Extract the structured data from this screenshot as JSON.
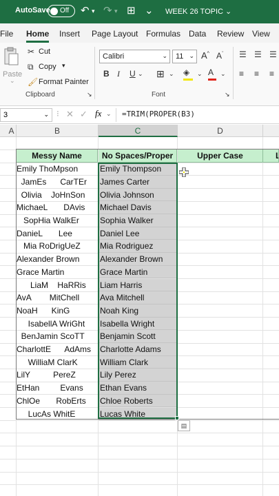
{
  "titlebar": {
    "autosave_label": "AutoSave",
    "toggle_state": "Off",
    "document_title": "WEEK 26 TOPIC"
  },
  "tabs": [
    "File",
    "Home",
    "Insert",
    "Page Layout",
    "Formulas",
    "Data",
    "Review",
    "View"
  ],
  "active_tab": "Home",
  "ribbon": {
    "clipboard": {
      "paste_label": "Paste",
      "cut_label": "Cut",
      "copy_label": "Copy",
      "format_painter_label": "Format Painter",
      "group_label": "Clipboard"
    },
    "font": {
      "font_name": "Calibri",
      "font_size": "11",
      "group_label": "Font"
    }
  },
  "formula_bar": {
    "name_box": "3",
    "fx_label": "fx",
    "formula": "=TRIM(PROPER(B3)"
  },
  "columns": [
    "A",
    "B",
    "C",
    "D"
  ],
  "table": {
    "headers": [
      "Messy Name",
      "No Spaces/Proper",
      "Upper Case"
    ],
    "next_header_fragment": "L",
    "rows": [
      {
        "messy": "Emily ThoMpson",
        "clean": "Emily Thompson"
      },
      {
        "messy": "  JamEs      CarTEr",
        "clean": "James Carter"
      },
      {
        "messy": "  Olivia    JoHnSon",
        "clean": "Olivia Johnson"
      },
      {
        "messy": "MichaeL       DAvis",
        "clean": "Michael Davis"
      },
      {
        "messy": "   SopHia WalkEr",
        "clean": "Sophia Walker"
      },
      {
        "messy": "DanieL       Lee",
        "clean": "Daniel Lee"
      },
      {
        "messy": "   Mia RoDrigUeZ",
        "clean": "Mia Rodriguez"
      },
      {
        "messy": "Alexander Brown",
        "clean": "Alexander Brown"
      },
      {
        "messy": "Grace Martin",
        "clean": "Grace Martin"
      },
      {
        "messy": "      LiaM    HaRRis",
        "clean": "Liam Harris"
      },
      {
        "messy": "AvA        MitChell",
        "clean": "Ava Mitchell"
      },
      {
        "messy": "NoaH      KinG",
        "clean": "Noah King"
      },
      {
        "messy": "     IsabellA WriGht",
        "clean": "Isabella Wright"
      },
      {
        "messy": "  BenJamin ScoTT",
        "clean": "Benjamin Scott"
      },
      {
        "messy": "CharlottE      AdAms",
        "clean": "Charlotte Adams"
      },
      {
        "messy": "     WilliaM ClarK",
        "clean": "William Clark"
      },
      {
        "messy": "LilY          PereZ",
        "clean": "Lily Perez"
      },
      {
        "messy": "EtHan         Evans",
        "clean": "Ethan Evans"
      },
      {
        "messy": "ChlOe       RobErts",
        "clean": "Chloe Roberts"
      },
      {
        "messy": "     LucAs WhitE",
        "clean": "Lucas White"
      }
    ]
  },
  "colors": {
    "excel_green": "#1e6e42",
    "header_fill": "#c6efce",
    "selection_fill": "#d3d3d3"
  }
}
